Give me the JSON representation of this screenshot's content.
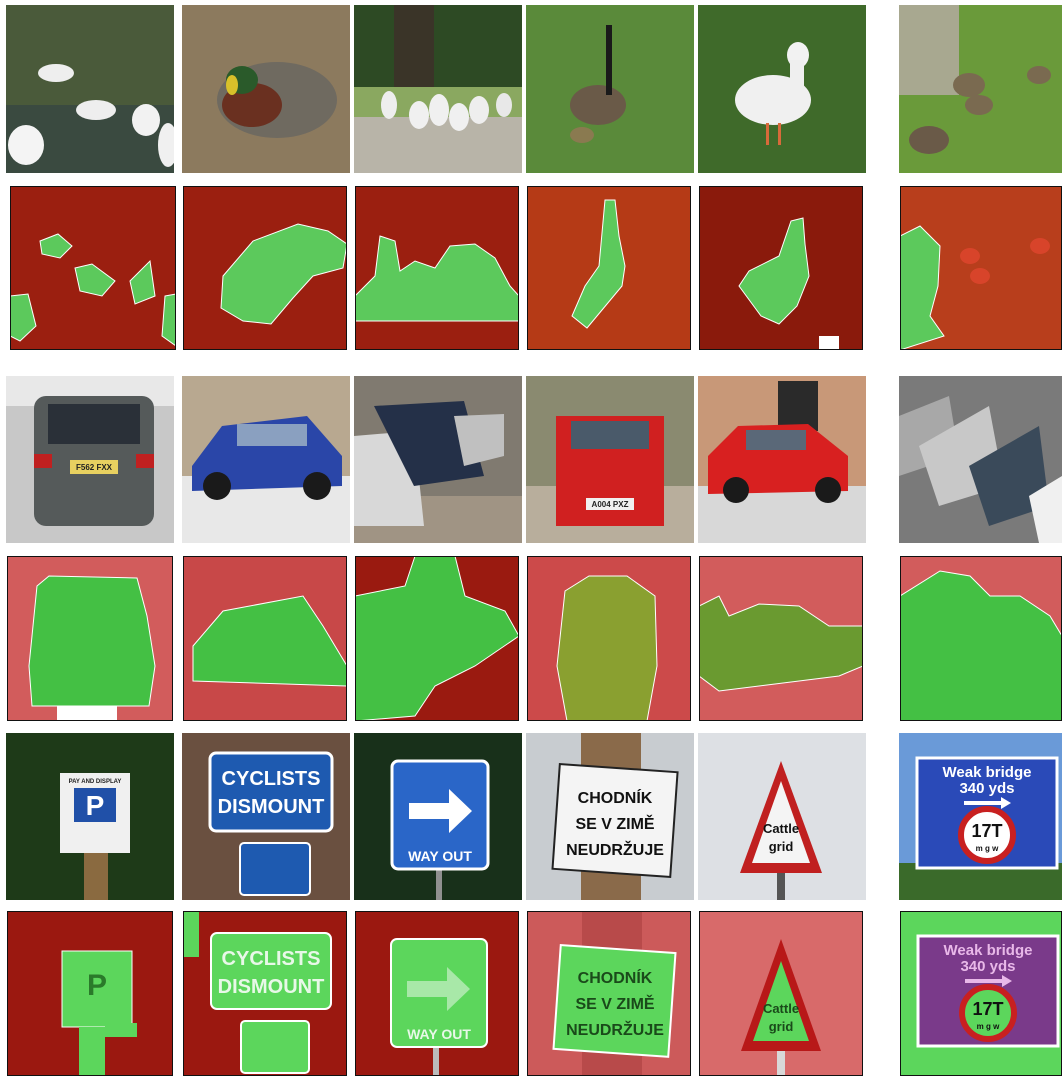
{
  "figure": {
    "rows": [
      {
        "name": "birds",
        "label_color": "#5cc95c",
        "bg_color": "#9b1f10"
      },
      {
        "name": "cars",
        "label_color": "#44c044",
        "bg_color": "#d25c5c"
      },
      {
        "name": "signs",
        "label_color": "#5cd65c",
        "bg_color": "#9b1810"
      }
    ],
    "signs": {
      "pay_display": "PAY AND DISPLAY",
      "parking_letter": "P",
      "cyclists_line1": "CYCLISTS",
      "cyclists_line2": "DISMOUNT",
      "way_out": "WAY OUT",
      "chodnik_line1": "CHODNÍK",
      "chodnik_line2": "SE V ZIMĚ",
      "chodnik_line3": "NEUDRŽUJE",
      "cattle_line1": "Cattle",
      "cattle_line2": "grid",
      "weak_bridge_line1": "Weak bridge",
      "weak_bridge_line2": "340 yds",
      "weight_limit": "17T",
      "weight_unit": "m g w"
    },
    "plates": {
      "car1": "F562 FXX",
      "car4": "A004 PXZ"
    }
  }
}
